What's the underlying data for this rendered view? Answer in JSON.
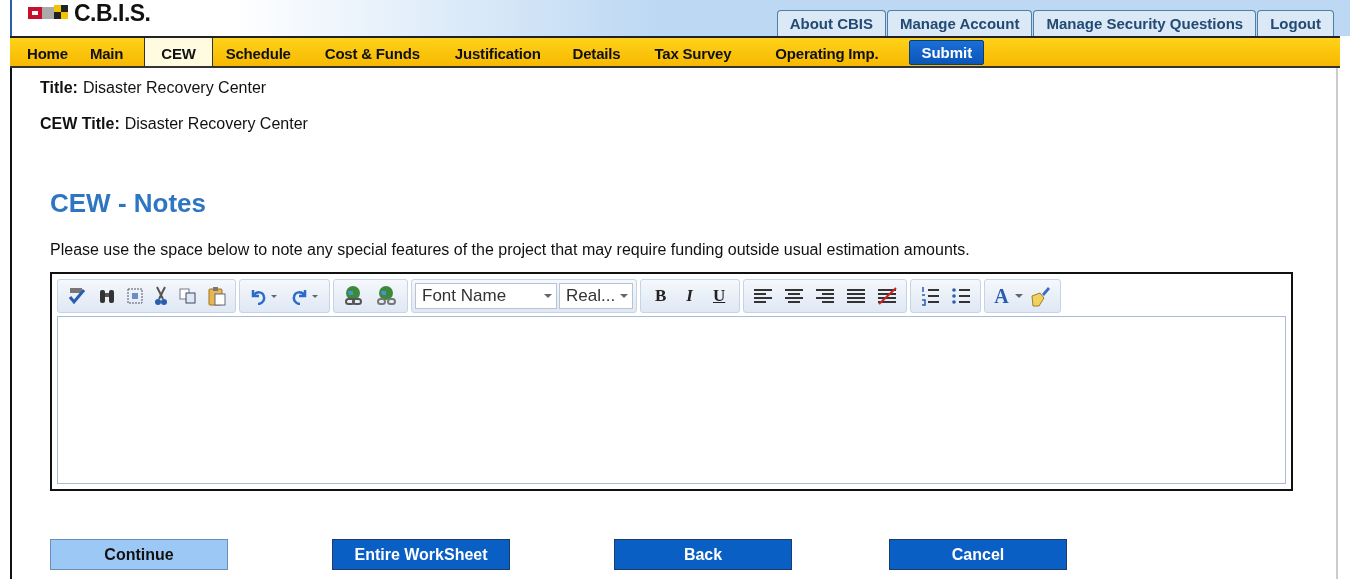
{
  "logo": {
    "text": "C.B.I.S."
  },
  "top_tabs": [
    "About CBIS",
    "Manage Account",
    "Manage Security Questions",
    "Logout"
  ],
  "nav": [
    {
      "label": "Home",
      "selected": false,
      "kind": "tab"
    },
    {
      "label": "Main",
      "selected": false,
      "kind": "tab"
    },
    {
      "label": "CEW",
      "selected": true,
      "kind": "tab"
    },
    {
      "label": "Schedule",
      "selected": false,
      "kind": "tab"
    },
    {
      "label": "Cost & Funds",
      "selected": false,
      "kind": "tab"
    },
    {
      "label": "Justification",
      "selected": false,
      "kind": "tab"
    },
    {
      "label": "Details",
      "selected": false,
      "kind": "tab"
    },
    {
      "label": "Tax Survey",
      "selected": false,
      "kind": "tab"
    },
    {
      "label": "Operating Imp.",
      "selected": false,
      "kind": "tab"
    },
    {
      "label": "Submit",
      "selected": false,
      "kind": "submit"
    }
  ],
  "fields": [
    {
      "label": "Title:",
      "value": "Disaster Recovery Center"
    },
    {
      "label": "CEW Title:",
      "value": "Disaster Recovery Center"
    }
  ],
  "heading": "CEW - Notes",
  "instructions": "Please use the space below to note any special features of the project that may require funding outside usual estimation amounts.",
  "toolbar": {
    "font_name": "Font Name",
    "font_size": "Real...",
    "bold": "B",
    "italic": "I",
    "underline": "U",
    "font_color": "A"
  },
  "buttons": [
    {
      "label": "Continue",
      "selected": true
    },
    {
      "label": "Entire WorkSheet",
      "selected": false
    },
    {
      "label": "Back",
      "selected": false
    },
    {
      "label": "Cancel",
      "selected": false
    }
  ]
}
